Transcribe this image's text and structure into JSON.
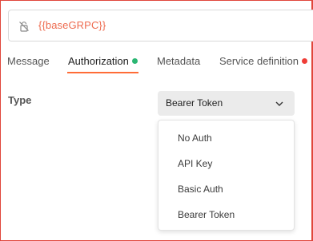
{
  "url_bar": {
    "value": "{{baseGRPC}}",
    "icon": "lock-off-icon"
  },
  "tabs": [
    {
      "label": "Message",
      "active": false,
      "indicator": null
    },
    {
      "label": "Authorization",
      "active": true,
      "indicator": "green"
    },
    {
      "label": "Metadata",
      "active": false,
      "indicator": null
    },
    {
      "label": "Service definition",
      "active": false,
      "indicator": "red"
    }
  ],
  "auth": {
    "type_label": "Type",
    "selected": "Bearer Token",
    "options": [
      "No Auth",
      "API Key",
      "Basic Auth",
      "Bearer Token"
    ]
  },
  "colors": {
    "accent": "#ff6c37",
    "variable_text": "#ee6b4f",
    "status_green": "#2bb673",
    "status_red": "#ef3d37",
    "frame_border": "#e0463b"
  }
}
